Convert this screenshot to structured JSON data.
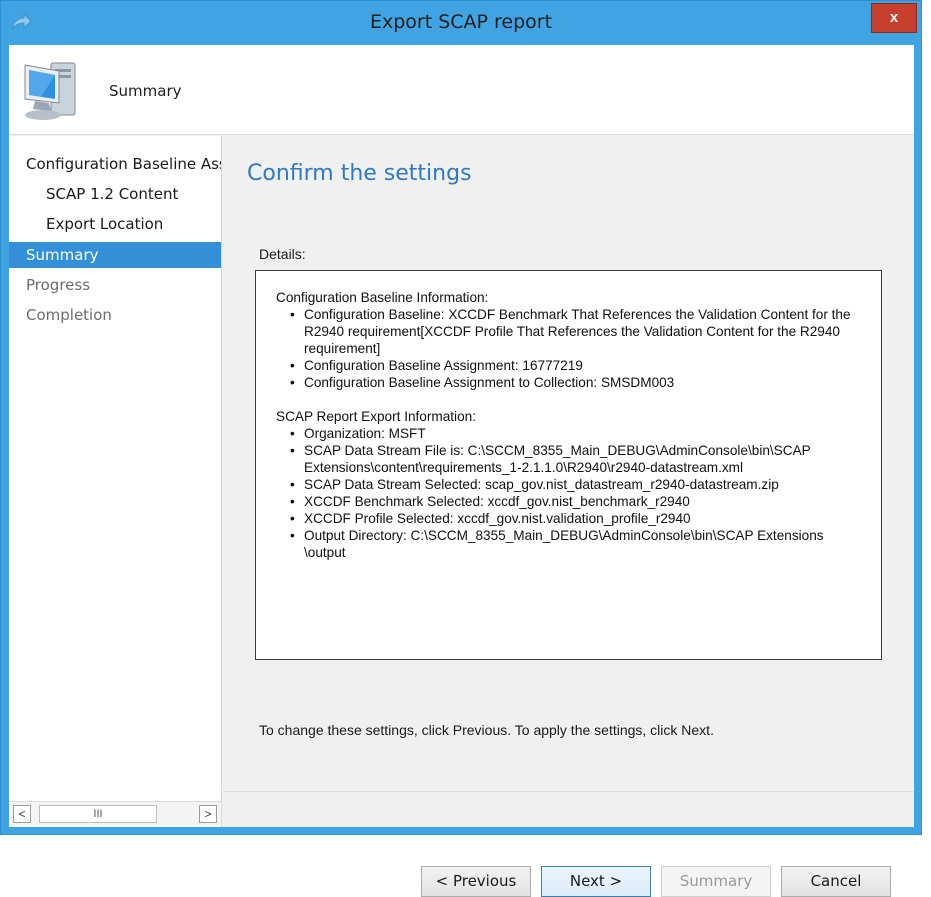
{
  "window": {
    "title": "Export SCAP report",
    "close_label": "x"
  },
  "header": {
    "title": "Summary"
  },
  "nav": {
    "items": [
      {
        "label": "Configuration Baseline Assignment"
      },
      {
        "label": "SCAP 1.2 Content"
      },
      {
        "label": "Export Location"
      },
      {
        "label": "Summary"
      },
      {
        "label": "Progress"
      },
      {
        "label": "Completion"
      }
    ],
    "scroll_left": "<",
    "scroll_right": ">",
    "scroll_thumb": "III"
  },
  "main": {
    "heading": "Confirm the settings",
    "details_label": "Details:",
    "baseline_section": {
      "title": "Configuration Baseline Information:",
      "items": [
        "Configuration Baseline: XCCDF Benchmark That References the Validation Content for the R2940 requirement[XCCDF Profile That References the Validation Content for the R2940 requirement]",
        "Configuration Baseline Assignment: 16777219",
        "Configuration Baseline Assignment to Collection: SMSDM003"
      ]
    },
    "export_section": {
      "title": "SCAP Report Export Information:",
      "items": [
        "Organization: MSFT",
        "SCAP Data Stream File is: C:\\SCCM_8355_Main_DEBUG\\AdminConsole\\bin\\SCAP Extensions\\content\\requirements_1-2.1.1.0\\R2940\\r2940-datastream.xml",
        "SCAP Data Stream Selected: scap_gov.nist_datastream_r2940-datastream.zip",
        "XCCDF Benchmark Selected: xccdf_gov.nist_benchmark_r2940",
        "XCCDF Profile Selected: xccdf_gov.nist.validation_profile_r2940",
        "Output Directory: C:\\SCCM_8355_Main_DEBUG\\AdminConsole\\bin\\SCAP Extensions \\output"
      ]
    },
    "hint": "To change these settings, click Previous. To apply the settings, click Next."
  },
  "buttons": {
    "previous": "< Previous",
    "next": "Next >",
    "summary": "Summary",
    "cancel": "Cancel"
  },
  "colors": {
    "title_bar": "#3FA4E1",
    "selected_nav": "#3390D8",
    "heading": "#2E7AC4",
    "close_button": "#C7402E"
  }
}
